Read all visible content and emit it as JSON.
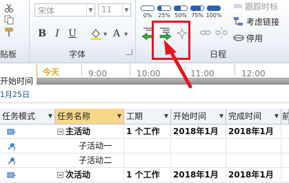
{
  "ribbon": {
    "clipboard_group": {
      "label": "贴板"
    },
    "font_group": {
      "label": "字体",
      "font_name": "宋体",
      "font_size": "11",
      "bold_label": "B",
      "italic_label": "I",
      "underline_label": "U",
      "font_color_label": "A"
    },
    "schedule_group": {
      "label": "日程",
      "percent_buttons": [
        {
          "label": "0%",
          "fill": 0
        },
        {
          "label": "25%",
          "fill": 0.25
        },
        {
          "label": "50%",
          "fill": 0.5
        },
        {
          "label": "75%",
          "fill": 0.75
        },
        {
          "label": "100%",
          "fill": 1
        }
      ],
      "top_right_label": "跟踪时标",
      "respect_links_label": "考虑链接",
      "inactivate_label": "停用"
    }
  },
  "timeline": {
    "today_label": "今天",
    "start_label": "开始时间",
    "start_date": "1月25日",
    "ticks": [
      "9:00",
      "10:00",
      "11:00",
      "12:00"
    ]
  },
  "table": {
    "columns": [
      "任务模式",
      "任务名称",
      "工期",
      "开始时间",
      "完成时间",
      "前"
    ],
    "rows": [
      {
        "name": "主活动",
        "duration": "1 个工作",
        "start": "2018年1月",
        "finish": "2018年1月",
        "summary": true,
        "mode": "auto"
      },
      {
        "name": "子活动一",
        "duration": "",
        "start": "",
        "finish": "",
        "summary": false,
        "mode": "manual"
      },
      {
        "name": "子活动二",
        "duration": "",
        "start": "",
        "finish": "",
        "summary": false,
        "mode": "manual"
      },
      {
        "name": "次活动",
        "duration": "1 个工作",
        "start": "2018年1月",
        "finish": "2018年1月",
        "summary": true,
        "mode": "auto"
      }
    ]
  },
  "colors": {
    "annotation": "#e5161c",
    "today": "#e8a21a",
    "selected_header": "#f8d788"
  }
}
